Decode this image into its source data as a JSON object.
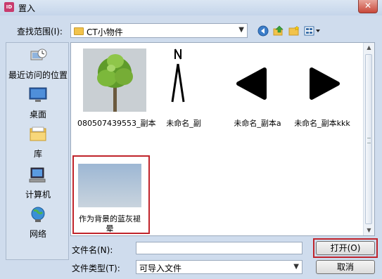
{
  "window": {
    "app_icon_text": "ID",
    "title": "置入",
    "close_label": "✕"
  },
  "lookin": {
    "label": "查找范围(I):",
    "value": "CT小物件"
  },
  "sidebar": {
    "items": [
      {
        "label": "最近访问的位置",
        "icon": "recent-places-icon"
      },
      {
        "label": "桌面",
        "icon": "desktop-icon"
      },
      {
        "label": "库",
        "icon": "libraries-icon"
      },
      {
        "label": "计算机",
        "icon": "computer-icon"
      },
      {
        "label": "网络",
        "icon": "network-icon"
      }
    ]
  },
  "files": [
    {
      "name": "080507439553_副本",
      "icon": "tree-image"
    },
    {
      "name": "未命名_副",
      "icon": "north-arrow-image"
    },
    {
      "name": "未命名_副本a",
      "icon": "left-triangle-image"
    },
    {
      "name": "未命名_副本kkk",
      "icon": "right-triangle-image"
    },
    {
      "name_line1": "作为背景的蓝灰褪",
      "name_line2": "晕",
      "icon": "blue-gray-gradient-image",
      "selected": true
    }
  ],
  "form": {
    "filename_label": "文件名(N):",
    "filename_value": "",
    "filetype_label": "文件类型(T):",
    "filetype_value": "可导入文件"
  },
  "buttons": {
    "open": "打开(O)",
    "cancel": "取消"
  },
  "colors": {
    "highlight": "#c0242b",
    "background": "#cfdced"
  }
}
